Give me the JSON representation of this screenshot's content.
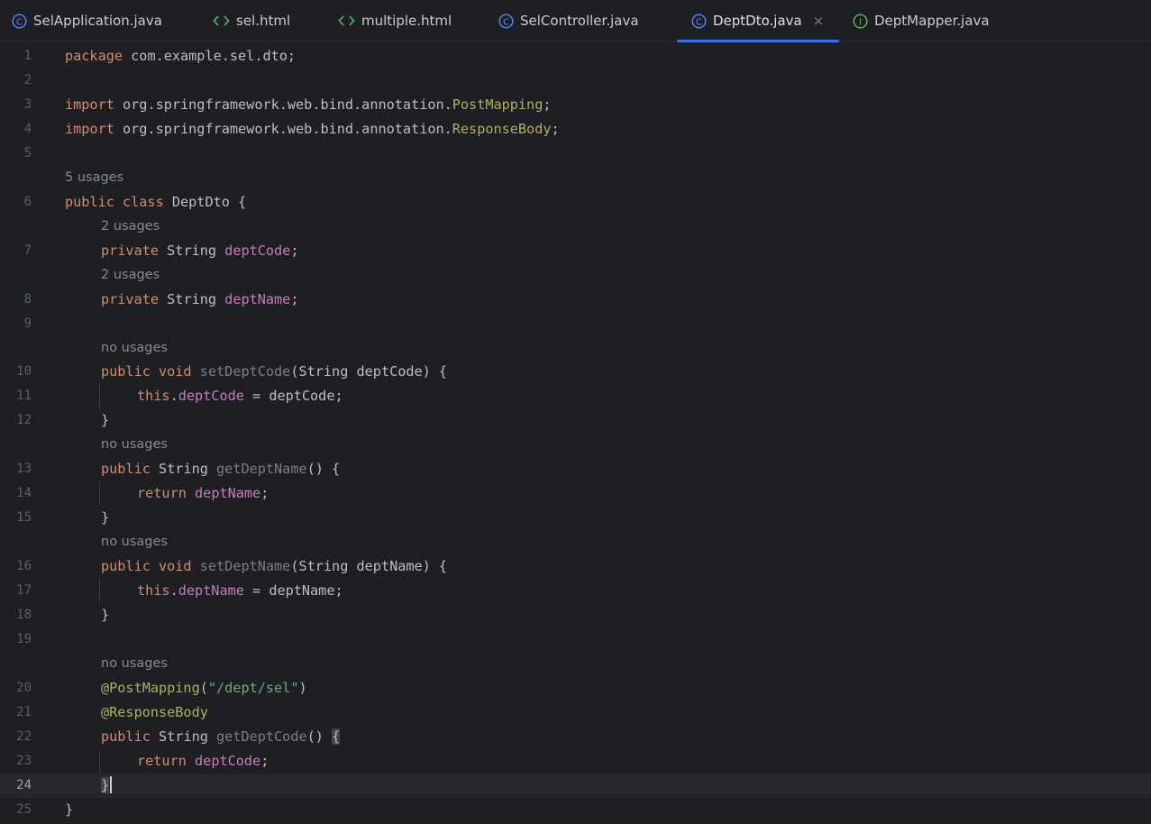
{
  "tabs": [
    {
      "label": "SelApplication.java",
      "icon": "java-class-icon",
      "active": false
    },
    {
      "label": "sel.html",
      "icon": "html-file-icon",
      "active": false
    },
    {
      "label": "multiple.html",
      "icon": "html-file-icon",
      "active": false
    },
    {
      "label": "SelController.java",
      "icon": "java-class-icon",
      "active": false
    },
    {
      "label": "DeptDto.java",
      "icon": "java-class-icon",
      "active": true,
      "close": "×"
    },
    {
      "label": "DeptMapper.java",
      "icon": "java-interface-icon",
      "active": false
    }
  ],
  "editor": {
    "current_line": "24",
    "lines": [
      {
        "n": "1",
        "code": "package com.example.sel.dto;"
      },
      {
        "n": "2",
        "code": ""
      },
      {
        "n": "3",
        "code": "import org.springframework.web.bind.annotation.PostMapping;"
      },
      {
        "n": "4",
        "code": "import org.springframework.web.bind.annotation.ResponseBody;"
      },
      {
        "n": "5",
        "code": ""
      },
      {
        "n": "6",
        "code": "public class DeptDto {",
        "hint": "5 usages"
      },
      {
        "n": "7",
        "code": "private String deptCode;",
        "hint": "2 usages"
      },
      {
        "n": "8",
        "code": "private String deptName;",
        "hint": "2 usages"
      },
      {
        "n": "9",
        "code": ""
      },
      {
        "n": "10",
        "code": "public void setDeptCode(String deptCode) {",
        "hint": "no usages"
      },
      {
        "n": "11",
        "code": "this.deptCode = deptCode;"
      },
      {
        "n": "12",
        "code": "}"
      },
      {
        "n": "13",
        "code": "public String getDeptName() {",
        "hint": "no usages"
      },
      {
        "n": "14",
        "code": "return deptName;"
      },
      {
        "n": "15",
        "code": "}"
      },
      {
        "n": "16",
        "code": "public void setDeptName(String deptName) {",
        "hint": "no usages"
      },
      {
        "n": "17",
        "code": "this.deptName = deptName;"
      },
      {
        "n": "18",
        "code": "}"
      },
      {
        "n": "19",
        "code": ""
      },
      {
        "n": "20",
        "code": "@PostMapping(\"/dept/sel\")",
        "hint": "no usages"
      },
      {
        "n": "21",
        "code": "@ResponseBody"
      },
      {
        "n": "22",
        "code": "public String getDeptCode() {"
      },
      {
        "n": "23",
        "code": "return deptCode;"
      },
      {
        "n": "24",
        "code": "}"
      },
      {
        "n": "25",
        "code": "}"
      }
    ]
  },
  "colors": {
    "background": "#1e1f22",
    "keyword": "#cf8e6d",
    "annotation": "#b3ae60",
    "field": "#c77dbb",
    "string": "#6aab73",
    "tab_underline": "#3574f0"
  }
}
